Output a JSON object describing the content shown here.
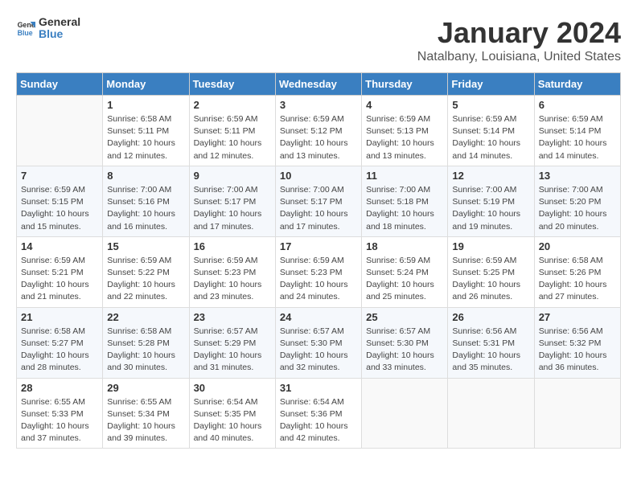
{
  "header": {
    "logo": {
      "text_general": "General",
      "text_blue": "Blue"
    },
    "title": "January 2024",
    "subtitle": "Natalbany, Louisiana, United States"
  },
  "calendar": {
    "days_of_week": [
      "Sunday",
      "Monday",
      "Tuesday",
      "Wednesday",
      "Thursday",
      "Friday",
      "Saturday"
    ],
    "weeks": [
      [
        {
          "day": "",
          "sunrise": "",
          "sunset": "",
          "daylight": ""
        },
        {
          "day": "1",
          "sunrise": "Sunrise: 6:58 AM",
          "sunset": "Sunset: 5:11 PM",
          "daylight": "Daylight: 10 hours and 12 minutes."
        },
        {
          "day": "2",
          "sunrise": "Sunrise: 6:59 AM",
          "sunset": "Sunset: 5:11 PM",
          "daylight": "Daylight: 10 hours and 12 minutes."
        },
        {
          "day": "3",
          "sunrise": "Sunrise: 6:59 AM",
          "sunset": "Sunset: 5:12 PM",
          "daylight": "Daylight: 10 hours and 13 minutes."
        },
        {
          "day": "4",
          "sunrise": "Sunrise: 6:59 AM",
          "sunset": "Sunset: 5:13 PM",
          "daylight": "Daylight: 10 hours and 13 minutes."
        },
        {
          "day": "5",
          "sunrise": "Sunrise: 6:59 AM",
          "sunset": "Sunset: 5:14 PM",
          "daylight": "Daylight: 10 hours and 14 minutes."
        },
        {
          "day": "6",
          "sunrise": "Sunrise: 6:59 AM",
          "sunset": "Sunset: 5:14 PM",
          "daylight": "Daylight: 10 hours and 14 minutes."
        }
      ],
      [
        {
          "day": "7",
          "sunrise": "Sunrise: 6:59 AM",
          "sunset": "Sunset: 5:15 PM",
          "daylight": "Daylight: 10 hours and 15 minutes."
        },
        {
          "day": "8",
          "sunrise": "Sunrise: 7:00 AM",
          "sunset": "Sunset: 5:16 PM",
          "daylight": "Daylight: 10 hours and 16 minutes."
        },
        {
          "day": "9",
          "sunrise": "Sunrise: 7:00 AM",
          "sunset": "Sunset: 5:17 PM",
          "daylight": "Daylight: 10 hours and 17 minutes."
        },
        {
          "day": "10",
          "sunrise": "Sunrise: 7:00 AM",
          "sunset": "Sunset: 5:17 PM",
          "daylight": "Daylight: 10 hours and 17 minutes."
        },
        {
          "day": "11",
          "sunrise": "Sunrise: 7:00 AM",
          "sunset": "Sunset: 5:18 PM",
          "daylight": "Daylight: 10 hours and 18 minutes."
        },
        {
          "day": "12",
          "sunrise": "Sunrise: 7:00 AM",
          "sunset": "Sunset: 5:19 PM",
          "daylight": "Daylight: 10 hours and 19 minutes."
        },
        {
          "day": "13",
          "sunrise": "Sunrise: 7:00 AM",
          "sunset": "Sunset: 5:20 PM",
          "daylight": "Daylight: 10 hours and 20 minutes."
        }
      ],
      [
        {
          "day": "14",
          "sunrise": "Sunrise: 6:59 AM",
          "sunset": "Sunset: 5:21 PM",
          "daylight": "Daylight: 10 hours and 21 minutes."
        },
        {
          "day": "15",
          "sunrise": "Sunrise: 6:59 AM",
          "sunset": "Sunset: 5:22 PM",
          "daylight": "Daylight: 10 hours and 22 minutes."
        },
        {
          "day": "16",
          "sunrise": "Sunrise: 6:59 AM",
          "sunset": "Sunset: 5:23 PM",
          "daylight": "Daylight: 10 hours and 23 minutes."
        },
        {
          "day": "17",
          "sunrise": "Sunrise: 6:59 AM",
          "sunset": "Sunset: 5:23 PM",
          "daylight": "Daylight: 10 hours and 24 minutes."
        },
        {
          "day": "18",
          "sunrise": "Sunrise: 6:59 AM",
          "sunset": "Sunset: 5:24 PM",
          "daylight": "Daylight: 10 hours and 25 minutes."
        },
        {
          "day": "19",
          "sunrise": "Sunrise: 6:59 AM",
          "sunset": "Sunset: 5:25 PM",
          "daylight": "Daylight: 10 hours and 26 minutes."
        },
        {
          "day": "20",
          "sunrise": "Sunrise: 6:58 AM",
          "sunset": "Sunset: 5:26 PM",
          "daylight": "Daylight: 10 hours and 27 minutes."
        }
      ],
      [
        {
          "day": "21",
          "sunrise": "Sunrise: 6:58 AM",
          "sunset": "Sunset: 5:27 PM",
          "daylight": "Daylight: 10 hours and 28 minutes."
        },
        {
          "day": "22",
          "sunrise": "Sunrise: 6:58 AM",
          "sunset": "Sunset: 5:28 PM",
          "daylight": "Daylight: 10 hours and 30 minutes."
        },
        {
          "day": "23",
          "sunrise": "Sunrise: 6:57 AM",
          "sunset": "Sunset: 5:29 PM",
          "daylight": "Daylight: 10 hours and 31 minutes."
        },
        {
          "day": "24",
          "sunrise": "Sunrise: 6:57 AM",
          "sunset": "Sunset: 5:30 PM",
          "daylight": "Daylight: 10 hours and 32 minutes."
        },
        {
          "day": "25",
          "sunrise": "Sunrise: 6:57 AM",
          "sunset": "Sunset: 5:30 PM",
          "daylight": "Daylight: 10 hours and 33 minutes."
        },
        {
          "day": "26",
          "sunrise": "Sunrise: 6:56 AM",
          "sunset": "Sunset: 5:31 PM",
          "daylight": "Daylight: 10 hours and 35 minutes."
        },
        {
          "day": "27",
          "sunrise": "Sunrise: 6:56 AM",
          "sunset": "Sunset: 5:32 PM",
          "daylight": "Daylight: 10 hours and 36 minutes."
        }
      ],
      [
        {
          "day": "28",
          "sunrise": "Sunrise: 6:55 AM",
          "sunset": "Sunset: 5:33 PM",
          "daylight": "Daylight: 10 hours and 37 minutes."
        },
        {
          "day": "29",
          "sunrise": "Sunrise: 6:55 AM",
          "sunset": "Sunset: 5:34 PM",
          "daylight": "Daylight: 10 hours and 39 minutes."
        },
        {
          "day": "30",
          "sunrise": "Sunrise: 6:54 AM",
          "sunset": "Sunset: 5:35 PM",
          "daylight": "Daylight: 10 hours and 40 minutes."
        },
        {
          "day": "31",
          "sunrise": "Sunrise: 6:54 AM",
          "sunset": "Sunset: 5:36 PM",
          "daylight": "Daylight: 10 hours and 42 minutes."
        },
        {
          "day": "",
          "sunrise": "",
          "sunset": "",
          "daylight": ""
        },
        {
          "day": "",
          "sunrise": "",
          "sunset": "",
          "daylight": ""
        },
        {
          "day": "",
          "sunrise": "",
          "sunset": "",
          "daylight": ""
        }
      ]
    ]
  }
}
